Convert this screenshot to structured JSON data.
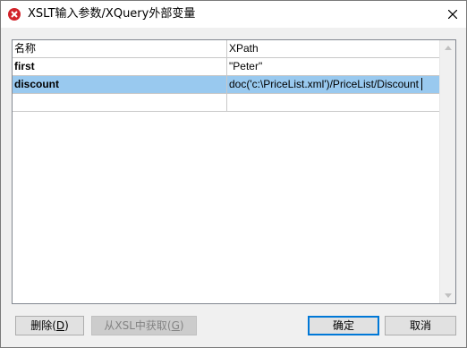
{
  "window": {
    "title": "XSLT输入参数/XQuery外部变量"
  },
  "icons": {
    "app": "xmlspy-logo-icon",
    "close": "close-icon",
    "scroll_up": "chevron-up-icon",
    "scroll_down": "chevron-down-icon"
  },
  "table": {
    "headers": [
      "名称",
      "XPath"
    ],
    "rows": [
      {
        "name": "first",
        "xpath": "\"Peter\"",
        "selected": false
      },
      {
        "name": "discount",
        "xpath": "doc('c:\\PriceList.xml')/PriceList/Discount",
        "selected": true
      },
      {
        "name": "",
        "xpath": "",
        "selected": false
      }
    ]
  },
  "buttons": {
    "delete": {
      "text": "删除(",
      "mnemonic": "D",
      "end": ")"
    },
    "from_xsl": {
      "text": "从XSL中获取(",
      "mnemonic": "G",
      "end": ")"
    },
    "ok": "确定",
    "cancel": "取消"
  },
  "colors": {
    "selection": "#99c9ef",
    "default_button_border": "#0078d7",
    "logo_red": "#d2232a"
  }
}
